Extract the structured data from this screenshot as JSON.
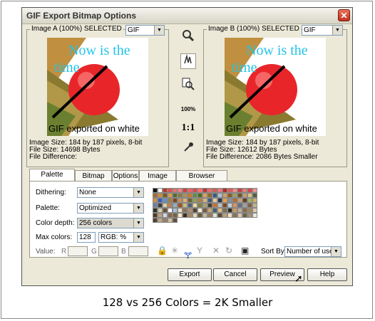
{
  "window": {
    "title": "GIF Export Bitmap Options",
    "close": "✕"
  },
  "image_a": {
    "label": "Image A (100%) SELECTED",
    "format": "GIF",
    "headline": "Now is the",
    "headline2": "time",
    "caption": "GIF exported on white",
    "size": "Image Size: 184 by 187 pixels, 8-bit",
    "file_size": "File Size: 14698 Bytes",
    "difference": "File Difference:"
  },
  "image_b": {
    "label": "Image B (100%) SELECTED",
    "format": "GIF",
    "headline": "Now is the",
    "headline2": "time",
    "caption": "GIF exported on white",
    "size": "Image Size: 184 by 187 pixels, 8-bit",
    "file_size": "File Size: 12612 Bytes",
    "difference": "File Difference: 2086 Bytes Smaller"
  },
  "tools": {
    "zoom_percent": "100%",
    "one_to_one": "1:1"
  },
  "tabs": [
    "Palette Options",
    "Bitmap Size",
    "Options",
    "Image Map",
    "Browser Preview"
  ],
  "palette": {
    "dithering_label": "Dithering:",
    "dithering_value": "None",
    "palette_label": "Palette:",
    "palette_value": "Optimized",
    "depth_label": "Color depth:",
    "depth_value": "256 colors",
    "max_label": "Max colors:",
    "max_value": "128",
    "colormodel": "RGB: %",
    "value_label": "Value:",
    "r": "R",
    "g": "G",
    "b": "B",
    "sortby_label": "Sort By:",
    "sortby_value": "Number of uses"
  },
  "buttons": {
    "export": "Export",
    "cancel": "Cancel",
    "preview": "Preview",
    "help": "Help"
  },
  "caption": "128 vs 256 Colors = 2K Smaller",
  "colors": {
    "accent_text": "#22c4e6",
    "ball": "#e8262a",
    "swatches": [
      "#111111",
      "#ffffff",
      "#c0392b",
      "#e05050",
      "#e87070",
      "#f08080",
      "#d04040",
      "#f06060",
      "#e04848",
      "#ff7070",
      "#c83030",
      "#e86868",
      "#d85858",
      "#f07878",
      "#b82828",
      "#e05858",
      "#ff8888",
      "#c84040",
      "#e87878",
      "#d04848",
      "#f09090",
      "#a86830",
      "#c89038",
      "#7a5a20",
      "#d4a048",
      "#5a6a30",
      "#8a7a40",
      "#b09050",
      "#c87830",
      "#6a8a40",
      "#4a6a28",
      "#e0a050",
      "#906830",
      "#3a5a80",
      "#b0c0d0",
      "#d0a060",
      "#8a5a28",
      "#a0a060",
      "#705020",
      "#c0a070",
      "#e0c080",
      "#506040",
      "#d09040",
      "#3060c0",
      "#6090d0",
      "#a08040",
      "#804818",
      "#c09060",
      "#e0b070",
      "#706030",
      "#90a050",
      "#b08040",
      "#d8b080",
      "#405a80",
      "#e8c898",
      "#203850",
      "#f0a040",
      "#8090a0",
      "#b07030",
      "#c8a080",
      "#604010",
      "#a0b070",
      "#d0b060",
      "#7080a0",
      "#3a3a3a",
      "#e0d0a0",
      "#c08050",
      "#90b0c0",
      "#a05020",
      "#c8c080",
      "#506070",
      "#f0d8a0",
      "#808040",
      "#b0a070",
      "#404030",
      "#d07030",
      "#c0c0c0",
      "#7a4a20",
      "#b8d0e0",
      "#e09060",
      "#607080",
      "#a0a0a0",
      "#806040",
      "#c0b090",
      "#303020",
      "#d8d0b0",
      "#6a5030",
      "#ffffff",
      "#a8c0d8",
      "#e8e0c8",
      "#907050",
      "#b09070",
      "#584028",
      "#f0f0e0",
      "#805830",
      "#c8a870",
      "#406070",
      "#e8b880",
      "#787050",
      "#2a2a20",
      "#d09858",
      "#b8b0a0",
      "#906840",
      "#a08858",
      "#e0c8a8",
      "#503818",
      "#c0a080",
      "#d0d8e0",
      "#886848",
      "#786040",
      "#f8e8c8",
      "#3a3020",
      "#a88860",
      "#e8d8b8",
      "#685838",
      "#c8b898",
      "#98785a",
      "#e0e0d8",
      "#584830",
      "#b8a078",
      "#f0e0c0",
      "#887058",
      "#d8c8a8",
      "#706048",
      "#a89070",
      "#e8e8e0",
      "#504030",
      "#c0a888",
      "#988060",
      "#d0c0a0",
      "#605040"
    ]
  }
}
